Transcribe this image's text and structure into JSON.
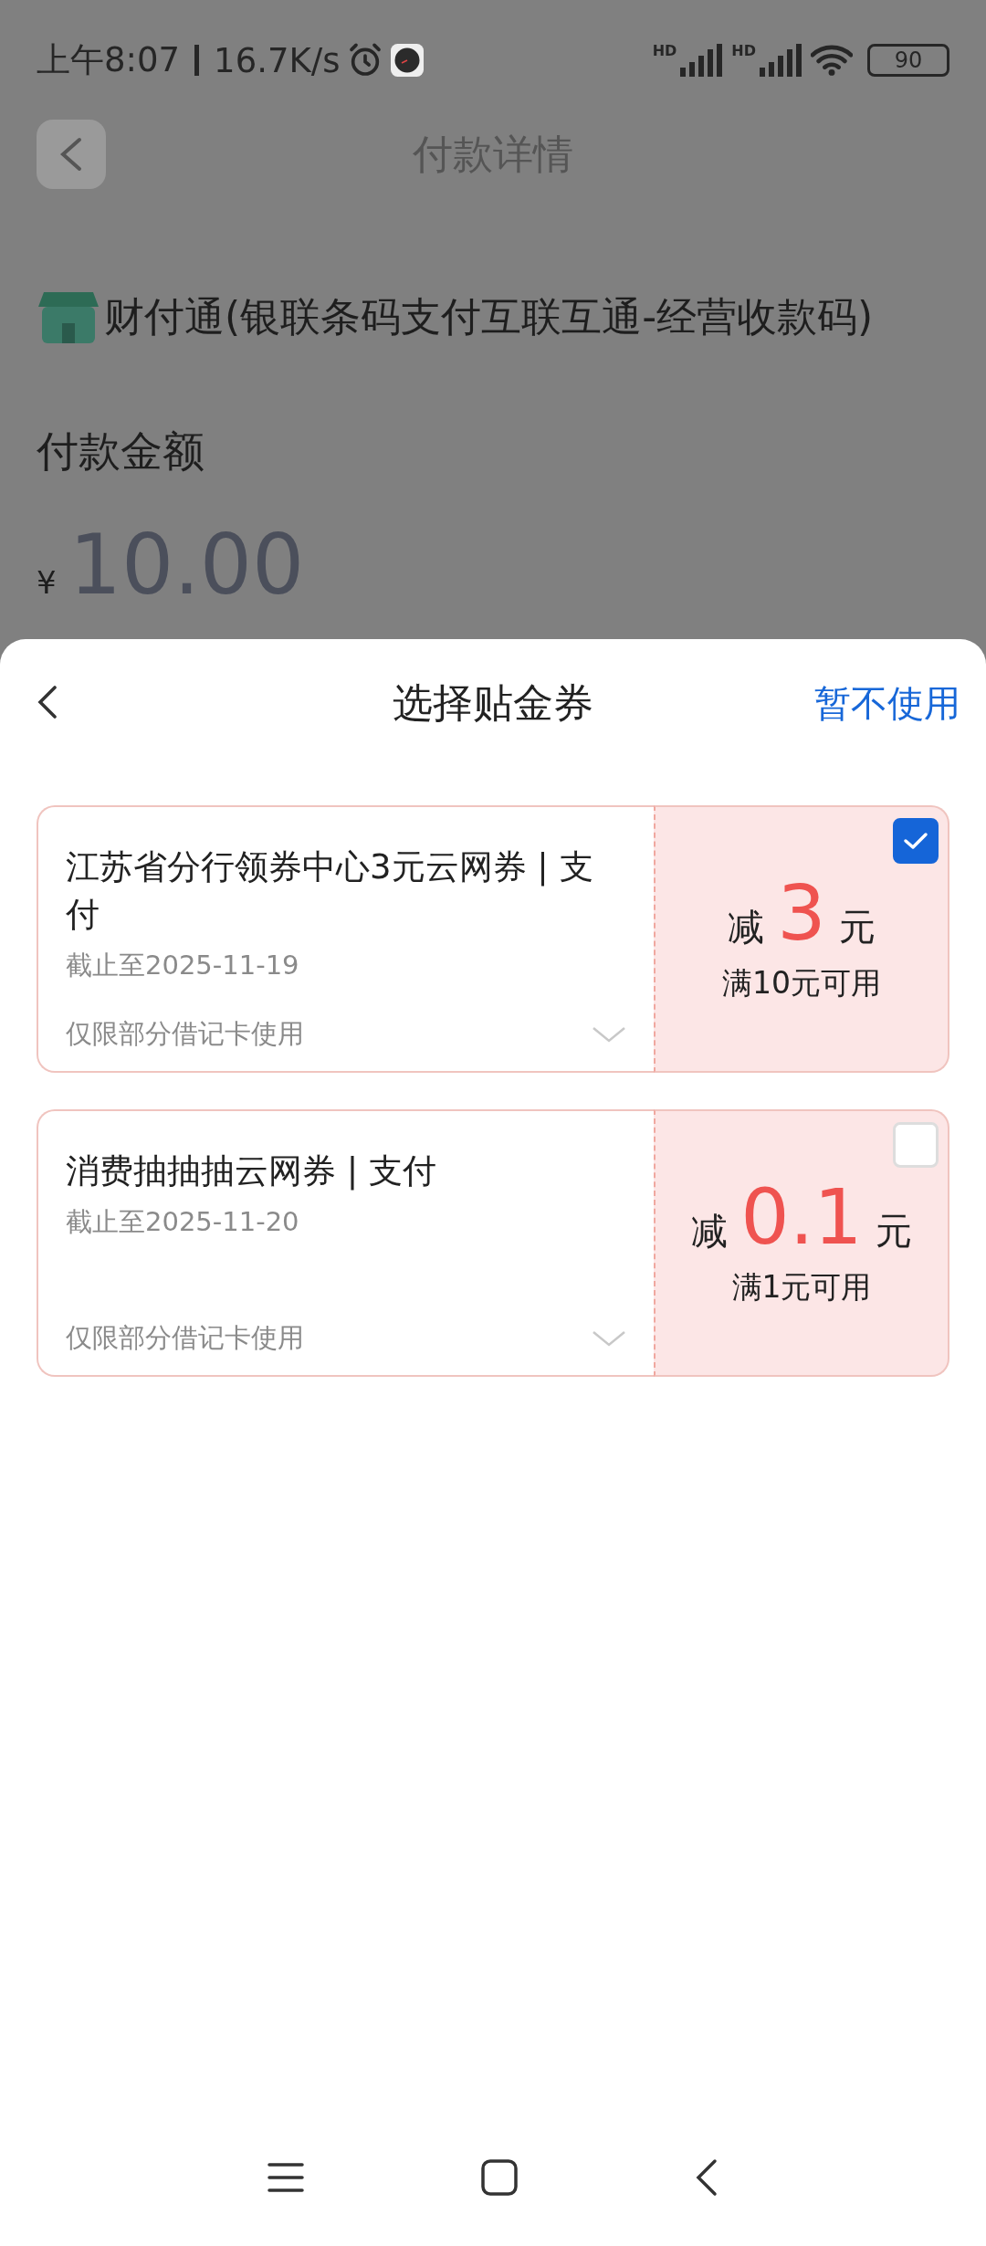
{
  "status_bar": {
    "time": "上午8:07",
    "speed": "16.7K/s",
    "battery": "90",
    "signals": [
      {
        "label": "HD"
      },
      {
        "label": "HD"
      }
    ]
  },
  "page": {
    "title": "付款详情",
    "merchant": "财付通(银联条码支付互联互通-经营收款码)",
    "amount_label": "付款金额",
    "currency": "¥",
    "amount": "10.00"
  },
  "sheet": {
    "title": "选择贴金券",
    "skip": "暂不使用",
    "coupons": [
      {
        "title": "江苏省分行领券中心3元云网券 | 支付",
        "expiry": "截止至2025-11-19",
        "restriction": "仅限部分借记卡使用",
        "prefix": "减",
        "value": "3",
        "unit": "元",
        "condition": "满10元可用",
        "selected": true
      },
      {
        "title": "消费抽抽抽云网券 | 支付",
        "expiry": "截止至2025-11-20",
        "restriction": "仅限部分借记卡使用",
        "prefix": "减",
        "value": "0.1",
        "unit": "元",
        "condition": "满1元可用",
        "selected": false
      }
    ]
  }
}
